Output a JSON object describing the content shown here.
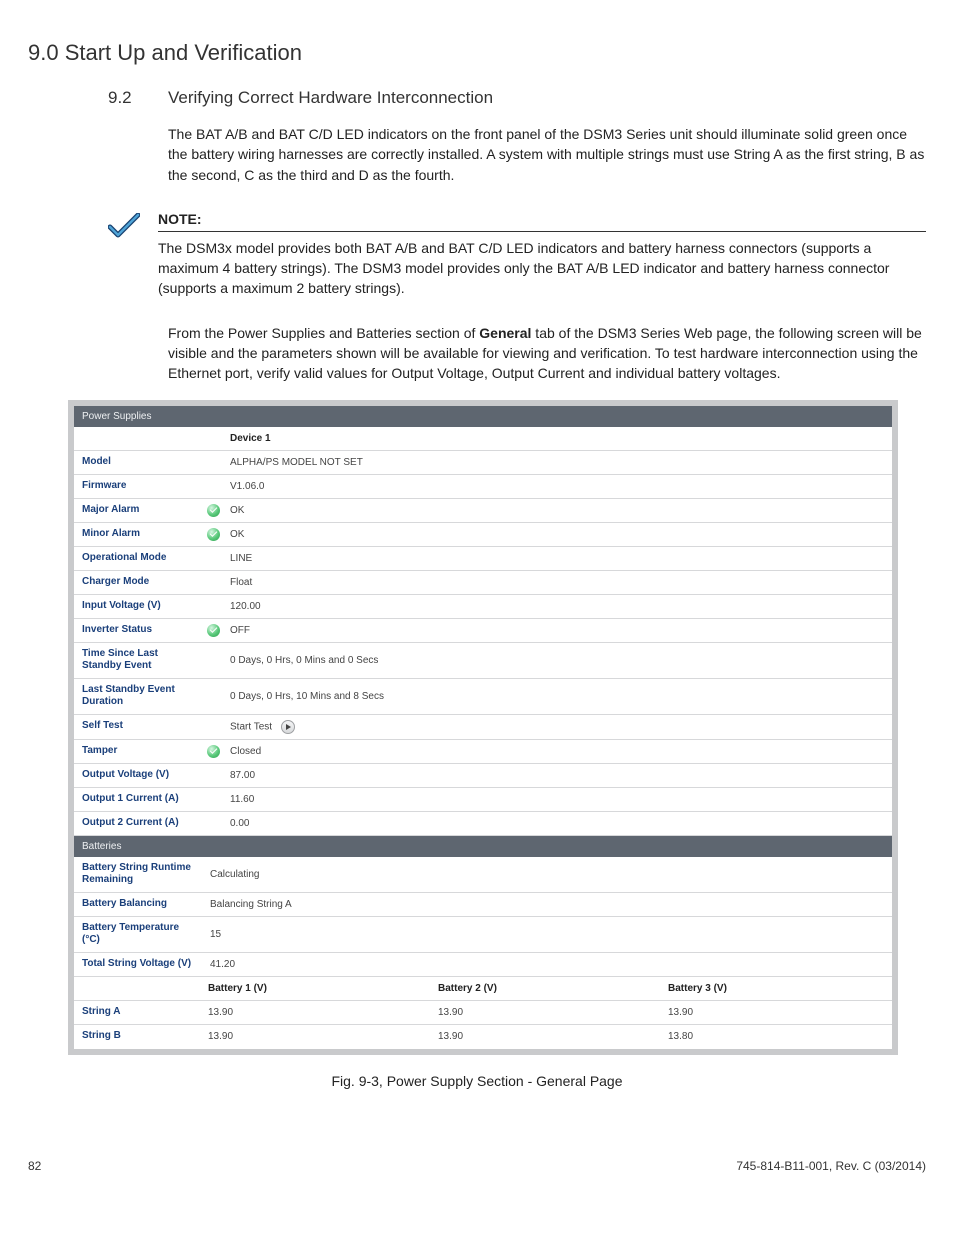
{
  "heading_main": "9.0 Start Up and Verification",
  "sub": {
    "num": "9.2",
    "title": "Verifying Correct Hardware Interconnection"
  },
  "para1": "The BAT A/B and BAT C/D LED indicators on the front panel of the DSM3 Series unit should illuminate solid green once the battery wiring harnesses are correctly installed. A system with multiple strings must use String A as the first string, B as the second, C as the third and D as the fourth.",
  "note": {
    "label": "NOTE:",
    "text": "The DSM3x model provides both BAT A/B and BAT C/D LED indicators and battery harness connectors (supports a maximum 4 battery strings). The DSM3 model provides only the BAT A/B LED indicator and battery harness connector (supports a maximum 2 battery strings)."
  },
  "para2a": "From the Power Supplies and Batteries section of ",
  "para2b": "General",
  "para2c": " tab of the DSM3 Series Web page, the following screen will be visible and the parameters shown will be available for viewing and verification. To test hardware interconnection using the Ethernet port, verify valid values for Output Voltage, Output Current and individual battery voltages.",
  "ps": {
    "section_title": "Power Supplies",
    "device_header": "Device 1",
    "rows": {
      "model": {
        "label": "Model",
        "value": "ALPHA/PS MODEL NOT SET"
      },
      "firmware": {
        "label": "Firmware",
        "value": "V1.06.0"
      },
      "major_alarm": {
        "label": "Major Alarm",
        "value": "OK",
        "icon": true
      },
      "minor_alarm": {
        "label": "Minor Alarm",
        "value": "OK",
        "icon": true
      },
      "op_mode": {
        "label": "Operational Mode",
        "value": "LINE"
      },
      "charger_mode": {
        "label": "Charger Mode",
        "value": "Float"
      },
      "input_v": {
        "label": "Input Voltage (V)",
        "value": "120.00"
      },
      "inverter": {
        "label": "Inverter Status",
        "value": "OFF",
        "icon": true
      },
      "tsl_standby": {
        "label": "Time Since Last Standby Event",
        "value": "0 Days, 0 Hrs, 0 Mins and 0 Secs"
      },
      "last_standby_dur": {
        "label": "Last Standby Event Duration",
        "value": "0 Days, 0 Hrs, 10 Mins and 8 Secs"
      },
      "self_test": {
        "label": "Self Test",
        "value": "Start Test"
      },
      "tamper": {
        "label": "Tamper",
        "value": "Closed",
        "icon": true
      },
      "output_v": {
        "label": "Output Voltage (V)",
        "value": "87.00"
      },
      "out1_a": {
        "label": "Output 1 Current (A)",
        "value": "11.60"
      },
      "out2_a": {
        "label": "Output 2 Current (A)",
        "value": "0.00"
      }
    }
  },
  "bat": {
    "section_title": "Batteries",
    "rows": {
      "runtime": {
        "label": "Battery String Runtime Remaining",
        "value": "Calculating"
      },
      "balancing": {
        "label": "Battery Balancing",
        "value": "Balancing String A"
      },
      "temp": {
        "label": "Battery Temperature (°C)",
        "value": "15"
      },
      "total_v": {
        "label": "Total String Voltage (V)",
        "value": "41.20"
      }
    },
    "col_headers": {
      "c1": "Battery 1 (V)",
      "c2": "Battery 2 (V)",
      "c3": "Battery 3 (V)"
    },
    "strings": {
      "a": {
        "label": "String A",
        "v1": "13.90",
        "v2": "13.90",
        "v3": "13.90"
      },
      "b": {
        "label": "String B",
        "v1": "13.90",
        "v2": "13.90",
        "v3": "13.80"
      }
    }
  },
  "figure_caption": "Fig. 9-3, Power Supply Section - General Page",
  "footer": {
    "page": "82",
    "doc": "745-814-B11-001, Rev. C (03/2014)"
  }
}
